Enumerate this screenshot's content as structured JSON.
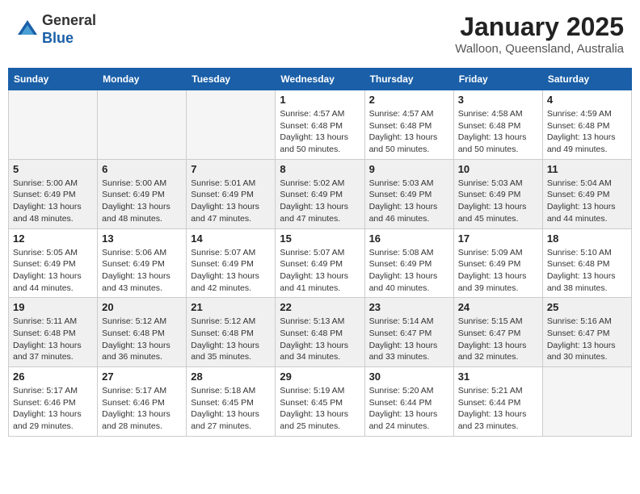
{
  "header": {
    "logo_general": "General",
    "logo_blue": "Blue",
    "month": "January 2025",
    "location": "Walloon, Queensland, Australia"
  },
  "weekdays": [
    "Sunday",
    "Monday",
    "Tuesday",
    "Wednesday",
    "Thursday",
    "Friday",
    "Saturday"
  ],
  "weeks": [
    [
      {
        "day": "",
        "info": ""
      },
      {
        "day": "",
        "info": ""
      },
      {
        "day": "",
        "info": ""
      },
      {
        "day": "1",
        "info": "Sunrise: 4:57 AM\nSunset: 6:48 PM\nDaylight: 13 hours\nand 50 minutes."
      },
      {
        "day": "2",
        "info": "Sunrise: 4:57 AM\nSunset: 6:48 PM\nDaylight: 13 hours\nand 50 minutes."
      },
      {
        "day": "3",
        "info": "Sunrise: 4:58 AM\nSunset: 6:48 PM\nDaylight: 13 hours\nand 50 minutes."
      },
      {
        "day": "4",
        "info": "Sunrise: 4:59 AM\nSunset: 6:48 PM\nDaylight: 13 hours\nand 49 minutes."
      }
    ],
    [
      {
        "day": "5",
        "info": "Sunrise: 5:00 AM\nSunset: 6:49 PM\nDaylight: 13 hours\nand 48 minutes."
      },
      {
        "day": "6",
        "info": "Sunrise: 5:00 AM\nSunset: 6:49 PM\nDaylight: 13 hours\nand 48 minutes."
      },
      {
        "day": "7",
        "info": "Sunrise: 5:01 AM\nSunset: 6:49 PM\nDaylight: 13 hours\nand 47 minutes."
      },
      {
        "day": "8",
        "info": "Sunrise: 5:02 AM\nSunset: 6:49 PM\nDaylight: 13 hours\nand 47 minutes."
      },
      {
        "day": "9",
        "info": "Sunrise: 5:03 AM\nSunset: 6:49 PM\nDaylight: 13 hours\nand 46 minutes."
      },
      {
        "day": "10",
        "info": "Sunrise: 5:03 AM\nSunset: 6:49 PM\nDaylight: 13 hours\nand 45 minutes."
      },
      {
        "day": "11",
        "info": "Sunrise: 5:04 AM\nSunset: 6:49 PM\nDaylight: 13 hours\nand 44 minutes."
      }
    ],
    [
      {
        "day": "12",
        "info": "Sunrise: 5:05 AM\nSunset: 6:49 PM\nDaylight: 13 hours\nand 44 minutes."
      },
      {
        "day": "13",
        "info": "Sunrise: 5:06 AM\nSunset: 6:49 PM\nDaylight: 13 hours\nand 43 minutes."
      },
      {
        "day": "14",
        "info": "Sunrise: 5:07 AM\nSunset: 6:49 PM\nDaylight: 13 hours\nand 42 minutes."
      },
      {
        "day": "15",
        "info": "Sunrise: 5:07 AM\nSunset: 6:49 PM\nDaylight: 13 hours\nand 41 minutes."
      },
      {
        "day": "16",
        "info": "Sunrise: 5:08 AM\nSunset: 6:49 PM\nDaylight: 13 hours\nand 40 minutes."
      },
      {
        "day": "17",
        "info": "Sunrise: 5:09 AM\nSunset: 6:49 PM\nDaylight: 13 hours\nand 39 minutes."
      },
      {
        "day": "18",
        "info": "Sunrise: 5:10 AM\nSunset: 6:48 PM\nDaylight: 13 hours\nand 38 minutes."
      }
    ],
    [
      {
        "day": "19",
        "info": "Sunrise: 5:11 AM\nSunset: 6:48 PM\nDaylight: 13 hours\nand 37 minutes."
      },
      {
        "day": "20",
        "info": "Sunrise: 5:12 AM\nSunset: 6:48 PM\nDaylight: 13 hours\nand 36 minutes."
      },
      {
        "day": "21",
        "info": "Sunrise: 5:12 AM\nSunset: 6:48 PM\nDaylight: 13 hours\nand 35 minutes."
      },
      {
        "day": "22",
        "info": "Sunrise: 5:13 AM\nSunset: 6:48 PM\nDaylight: 13 hours\nand 34 minutes."
      },
      {
        "day": "23",
        "info": "Sunrise: 5:14 AM\nSunset: 6:47 PM\nDaylight: 13 hours\nand 33 minutes."
      },
      {
        "day": "24",
        "info": "Sunrise: 5:15 AM\nSunset: 6:47 PM\nDaylight: 13 hours\nand 32 minutes."
      },
      {
        "day": "25",
        "info": "Sunrise: 5:16 AM\nSunset: 6:47 PM\nDaylight: 13 hours\nand 30 minutes."
      }
    ],
    [
      {
        "day": "26",
        "info": "Sunrise: 5:17 AM\nSunset: 6:46 PM\nDaylight: 13 hours\nand 29 minutes."
      },
      {
        "day": "27",
        "info": "Sunrise: 5:17 AM\nSunset: 6:46 PM\nDaylight: 13 hours\nand 28 minutes."
      },
      {
        "day": "28",
        "info": "Sunrise: 5:18 AM\nSunset: 6:45 PM\nDaylight: 13 hours\nand 27 minutes."
      },
      {
        "day": "29",
        "info": "Sunrise: 5:19 AM\nSunset: 6:45 PM\nDaylight: 13 hours\nand 25 minutes."
      },
      {
        "day": "30",
        "info": "Sunrise: 5:20 AM\nSunset: 6:44 PM\nDaylight: 13 hours\nand 24 minutes."
      },
      {
        "day": "31",
        "info": "Sunrise: 5:21 AM\nSunset: 6:44 PM\nDaylight: 13 hours\nand 23 minutes."
      },
      {
        "day": "",
        "info": ""
      }
    ]
  ]
}
